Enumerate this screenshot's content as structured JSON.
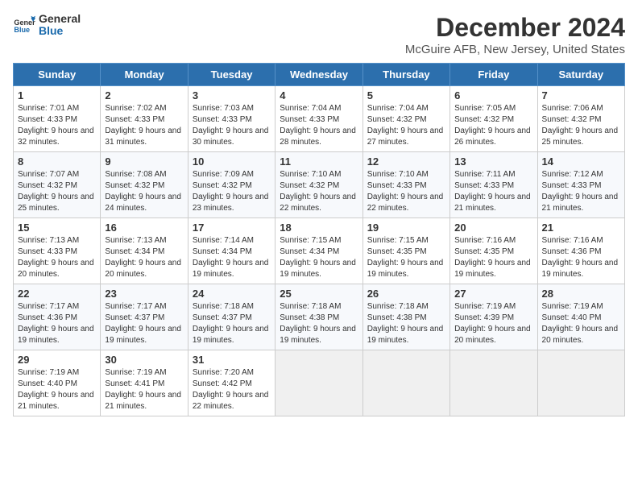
{
  "header": {
    "logo_line1": "General",
    "logo_line2": "Blue",
    "month": "December 2024",
    "location": "McGuire AFB, New Jersey, United States"
  },
  "weekdays": [
    "Sunday",
    "Monday",
    "Tuesday",
    "Wednesday",
    "Thursday",
    "Friday",
    "Saturday"
  ],
  "weeks": [
    [
      {
        "day": "1",
        "sunrise": "Sunrise: 7:01 AM",
        "sunset": "Sunset: 4:33 PM",
        "daylight": "Daylight: 9 hours and 32 minutes."
      },
      {
        "day": "2",
        "sunrise": "Sunrise: 7:02 AM",
        "sunset": "Sunset: 4:33 PM",
        "daylight": "Daylight: 9 hours and 31 minutes."
      },
      {
        "day": "3",
        "sunrise": "Sunrise: 7:03 AM",
        "sunset": "Sunset: 4:33 PM",
        "daylight": "Daylight: 9 hours and 30 minutes."
      },
      {
        "day": "4",
        "sunrise": "Sunrise: 7:04 AM",
        "sunset": "Sunset: 4:33 PM",
        "daylight": "Daylight: 9 hours and 28 minutes."
      },
      {
        "day": "5",
        "sunrise": "Sunrise: 7:04 AM",
        "sunset": "Sunset: 4:32 PM",
        "daylight": "Daylight: 9 hours and 27 minutes."
      },
      {
        "day": "6",
        "sunrise": "Sunrise: 7:05 AM",
        "sunset": "Sunset: 4:32 PM",
        "daylight": "Daylight: 9 hours and 26 minutes."
      },
      {
        "day": "7",
        "sunrise": "Sunrise: 7:06 AM",
        "sunset": "Sunset: 4:32 PM",
        "daylight": "Daylight: 9 hours and 25 minutes."
      }
    ],
    [
      {
        "day": "8",
        "sunrise": "Sunrise: 7:07 AM",
        "sunset": "Sunset: 4:32 PM",
        "daylight": "Daylight: 9 hours and 25 minutes."
      },
      {
        "day": "9",
        "sunrise": "Sunrise: 7:08 AM",
        "sunset": "Sunset: 4:32 PM",
        "daylight": "Daylight: 9 hours and 24 minutes."
      },
      {
        "day": "10",
        "sunrise": "Sunrise: 7:09 AM",
        "sunset": "Sunset: 4:32 PM",
        "daylight": "Daylight: 9 hours and 23 minutes."
      },
      {
        "day": "11",
        "sunrise": "Sunrise: 7:10 AM",
        "sunset": "Sunset: 4:32 PM",
        "daylight": "Daylight: 9 hours and 22 minutes."
      },
      {
        "day": "12",
        "sunrise": "Sunrise: 7:10 AM",
        "sunset": "Sunset: 4:33 PM",
        "daylight": "Daylight: 9 hours and 22 minutes."
      },
      {
        "day": "13",
        "sunrise": "Sunrise: 7:11 AM",
        "sunset": "Sunset: 4:33 PM",
        "daylight": "Daylight: 9 hours and 21 minutes."
      },
      {
        "day": "14",
        "sunrise": "Sunrise: 7:12 AM",
        "sunset": "Sunset: 4:33 PM",
        "daylight": "Daylight: 9 hours and 21 minutes."
      }
    ],
    [
      {
        "day": "15",
        "sunrise": "Sunrise: 7:13 AM",
        "sunset": "Sunset: 4:33 PM",
        "daylight": "Daylight: 9 hours and 20 minutes."
      },
      {
        "day": "16",
        "sunrise": "Sunrise: 7:13 AM",
        "sunset": "Sunset: 4:34 PM",
        "daylight": "Daylight: 9 hours and 20 minutes."
      },
      {
        "day": "17",
        "sunrise": "Sunrise: 7:14 AM",
        "sunset": "Sunset: 4:34 PM",
        "daylight": "Daylight: 9 hours and 19 minutes."
      },
      {
        "day": "18",
        "sunrise": "Sunrise: 7:15 AM",
        "sunset": "Sunset: 4:34 PM",
        "daylight": "Daylight: 9 hours and 19 minutes."
      },
      {
        "day": "19",
        "sunrise": "Sunrise: 7:15 AM",
        "sunset": "Sunset: 4:35 PM",
        "daylight": "Daylight: 9 hours and 19 minutes."
      },
      {
        "day": "20",
        "sunrise": "Sunrise: 7:16 AM",
        "sunset": "Sunset: 4:35 PM",
        "daylight": "Daylight: 9 hours and 19 minutes."
      },
      {
        "day": "21",
        "sunrise": "Sunrise: 7:16 AM",
        "sunset": "Sunset: 4:36 PM",
        "daylight": "Daylight: 9 hours and 19 minutes."
      }
    ],
    [
      {
        "day": "22",
        "sunrise": "Sunrise: 7:17 AM",
        "sunset": "Sunset: 4:36 PM",
        "daylight": "Daylight: 9 hours and 19 minutes."
      },
      {
        "day": "23",
        "sunrise": "Sunrise: 7:17 AM",
        "sunset": "Sunset: 4:37 PM",
        "daylight": "Daylight: 9 hours and 19 minutes."
      },
      {
        "day": "24",
        "sunrise": "Sunrise: 7:18 AM",
        "sunset": "Sunset: 4:37 PM",
        "daylight": "Daylight: 9 hours and 19 minutes."
      },
      {
        "day": "25",
        "sunrise": "Sunrise: 7:18 AM",
        "sunset": "Sunset: 4:38 PM",
        "daylight": "Daylight: 9 hours and 19 minutes."
      },
      {
        "day": "26",
        "sunrise": "Sunrise: 7:18 AM",
        "sunset": "Sunset: 4:38 PM",
        "daylight": "Daylight: 9 hours and 19 minutes."
      },
      {
        "day": "27",
        "sunrise": "Sunrise: 7:19 AM",
        "sunset": "Sunset: 4:39 PM",
        "daylight": "Daylight: 9 hours and 20 minutes."
      },
      {
        "day": "28",
        "sunrise": "Sunrise: 7:19 AM",
        "sunset": "Sunset: 4:40 PM",
        "daylight": "Daylight: 9 hours and 20 minutes."
      }
    ],
    [
      {
        "day": "29",
        "sunrise": "Sunrise: 7:19 AM",
        "sunset": "Sunset: 4:40 PM",
        "daylight": "Daylight: 9 hours and 21 minutes."
      },
      {
        "day": "30",
        "sunrise": "Sunrise: 7:19 AM",
        "sunset": "Sunset: 4:41 PM",
        "daylight": "Daylight: 9 hours and 21 minutes."
      },
      {
        "day": "31",
        "sunrise": "Sunrise: 7:20 AM",
        "sunset": "Sunset: 4:42 PM",
        "daylight": "Daylight: 9 hours and 22 minutes."
      },
      null,
      null,
      null,
      null
    ]
  ]
}
